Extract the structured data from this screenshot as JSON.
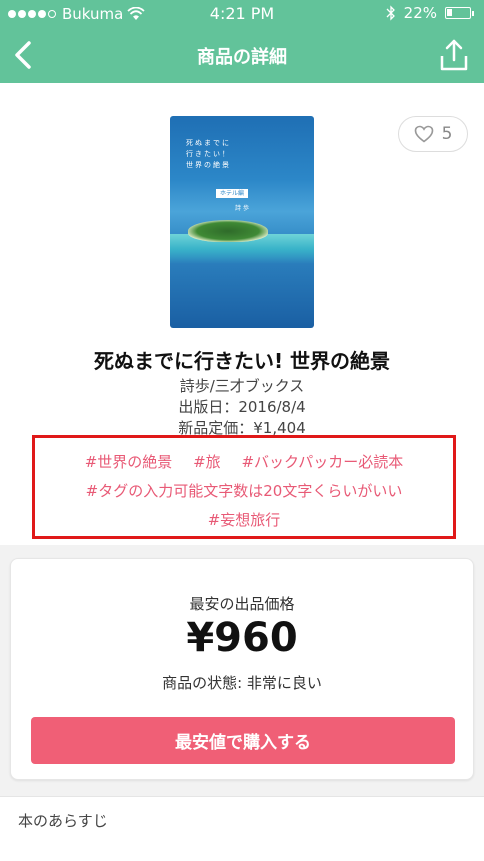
{
  "status_bar": {
    "carrier": "Bukuma",
    "time": "4:21 PM",
    "battery": "22%",
    "signal_dots_filled": 4
  },
  "nav": {
    "title": "商品の詳細",
    "back_icon": "chevron-left-icon",
    "share_icon": "share-icon"
  },
  "book": {
    "cover": {
      "title_lines": [
        "死ぬまでに",
        "行きたい！",
        "世界の絶景"
      ],
      "badge": "ホテル編",
      "author": "詩 歩"
    },
    "likes": "5",
    "title": "死ぬまでに行きたい! 世界の絶景",
    "author_publisher": "詩歩/三才ブックス",
    "release_date": "出版日：2016/8/4",
    "list_price": "新品定価：¥1,404"
  },
  "tags": {
    "line1": [
      "#世界の絶景",
      "#旅",
      "#バックパッカー必読本"
    ],
    "line2": "#タグの入力可能文字数は20文字くらいがいい",
    "line3": "#妄想旅行"
  },
  "price": {
    "label": "最安の出品価格",
    "value": "¥960",
    "condition": "商品の状態: 非常に良い",
    "buy_button": "最安値で購入する"
  },
  "synopsis": {
    "label": "本のあらすじ"
  },
  "colors": {
    "header": "#62c39a",
    "tag": "#e85a76",
    "buy_button": "#f05f76",
    "highlight_border": "#e01818"
  }
}
